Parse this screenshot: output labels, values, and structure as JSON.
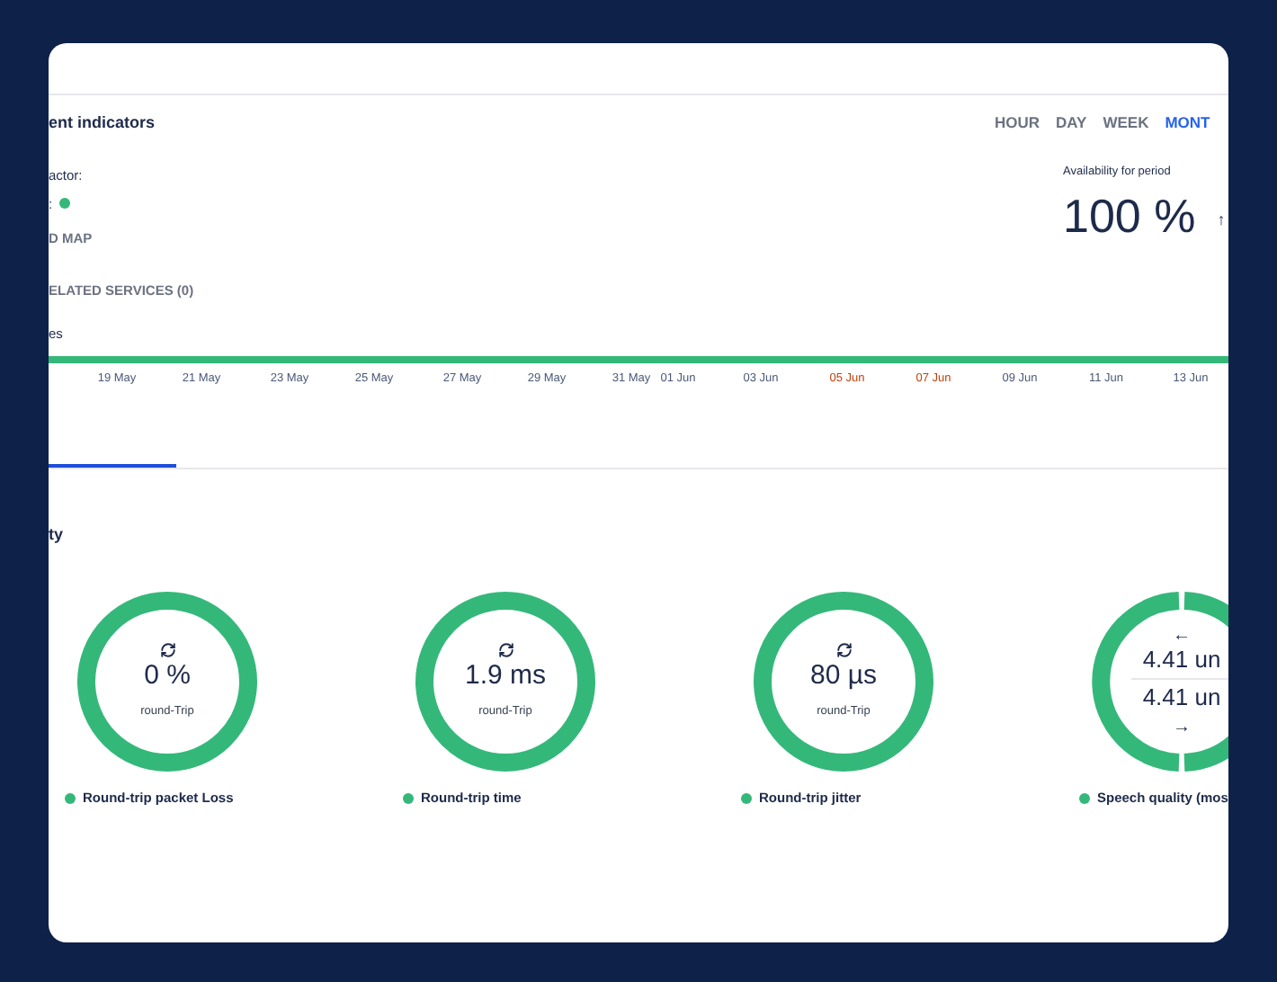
{
  "section_title": "ent indicators",
  "period_tabs": [
    {
      "label": "HOUR",
      "selected": false
    },
    {
      "label": "DAY",
      "selected": false
    },
    {
      "label": "WEEK",
      "selected": false
    },
    {
      "label": "MONT",
      "selected": true
    }
  ],
  "info_lines": [
    {
      "kind": "text",
      "text": "actor:"
    },
    {
      "kind": "status",
      "text": ":",
      "color": "#34b87a"
    },
    {
      "kind": "link",
      "text": "D MAP"
    },
    {
      "kind": "link",
      "text": "ELATED SERVICES (0)"
    },
    {
      "kind": "text",
      "text": "es"
    }
  ],
  "availability": {
    "label": "Availability for period",
    "value": "100 %",
    "trend": "↑"
  },
  "timeline": {
    "ticks": [
      {
        "label": "19 May",
        "highlight": false
      },
      {
        "label": "21 May",
        "highlight": false
      },
      {
        "label": "23 May",
        "highlight": false
      },
      {
        "label": "25 May",
        "highlight": false
      },
      {
        "label": "27 May",
        "highlight": false
      },
      {
        "label": "29 May",
        "highlight": false
      },
      {
        "label": "31 May",
        "highlight": false
      },
      {
        "label": "01 Jun",
        "highlight": false
      },
      {
        "label": "03 Jun",
        "highlight": false
      },
      {
        "label": "05 Jun",
        "highlight": true
      },
      {
        "label": "07 Jun",
        "highlight": true
      },
      {
        "label": "09 Jun",
        "highlight": false
      },
      {
        "label": "11 Jun",
        "highlight": false
      },
      {
        "label": "13 Jun",
        "highlight": false
      }
    ]
  },
  "detail_tabs": [
    {
      "selected": true
    }
  ],
  "quality_title": "ty",
  "gauges": [
    {
      "kind": "single",
      "value": "0 %",
      "caption": "round-Trip",
      "label": "Round-trip packet Loss",
      "color": "#34b87a"
    },
    {
      "kind": "single",
      "value": "1.9 ms",
      "caption": "round-Trip",
      "label": "Round-trip time",
      "color": "#34b87a"
    },
    {
      "kind": "single",
      "value": "80 µs",
      "caption": "round-Trip",
      "label": "Round-trip jitter",
      "color": "#34b87a"
    },
    {
      "kind": "split",
      "in": "4.41 un",
      "out": "4.41 un",
      "in_arrow": "←",
      "out_arrow": "→",
      "label": "Speech quality (mos",
      "color": "#34b87a"
    }
  ]
}
